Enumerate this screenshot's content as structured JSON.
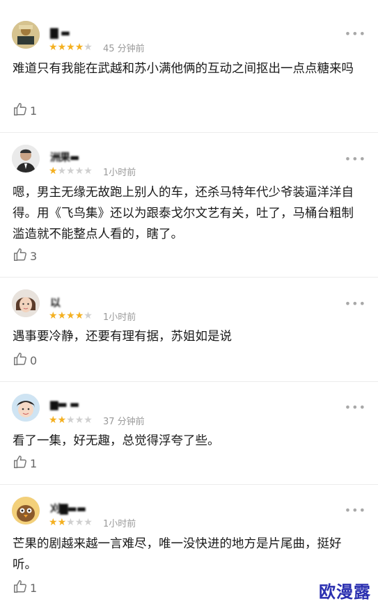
{
  "comments": [
    {
      "username": "▇ ▬",
      "rating": 4,
      "time": "45 分钟前",
      "text": "难道只有我能在武越和苏小满他俩的互动之间抠出一点点糖来吗",
      "likes": "1",
      "avatar": "cartoon-figure"
    },
    {
      "username": "洲果▬",
      "rating": 1,
      "time": "1小时前",
      "text": "嗯，男主无缘无故跑上别人的车，还杀马特年代少爷装逼洋洋自得。用《飞鸟集》还以为跟泰戈尔文艺有关，吐了，马桶台粗制滥造就不能整点人看的，瞎了。",
      "likes": "3",
      "avatar": "man-in-suit"
    },
    {
      "username": "以",
      "rating": 4,
      "time": "1小时前",
      "text": "遇事要冷静，还要有理有据，苏姐如是说",
      "likes": "0",
      "avatar": "woman-face"
    },
    {
      "username": "▆▬ ▬",
      "rating": 2,
      "time": "37 分钟前",
      "text": "看了一集，好无趣，总觉得浮夸了些。",
      "likes": "1",
      "avatar": "child-face"
    },
    {
      "username": "刈▇▬▬",
      "rating": 2,
      "time": "1小时前",
      "text": "芒果的剧越来越一言难尽，唯一没快进的地方是片尾曲，挺好听。",
      "likes": "1",
      "avatar": "cartoon-bird"
    }
  ],
  "watermark": "欧漫露",
  "colors": {
    "star_on": "#f4b020",
    "star_off": "#d0d0d0",
    "watermark": "#2a2fb0"
  }
}
